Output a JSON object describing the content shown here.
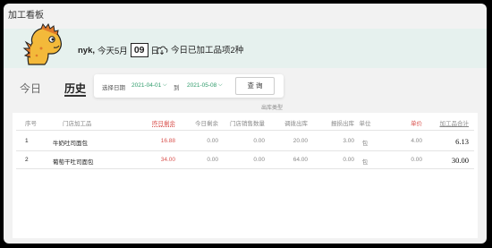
{
  "window": {
    "title": "加工看板"
  },
  "hero": {
    "user_name": "nyk,",
    "today_prefix": "今天5月",
    "day": "09",
    "day_suffix": "日",
    "processed_text": "今日已加工品项2种"
  },
  "tabs": [
    {
      "label": "今日",
      "active": false
    },
    {
      "label": "历史",
      "active": true
    }
  ],
  "filter": {
    "date_label": "选择日期",
    "start_date": "2021-04-01",
    "to_label": "到",
    "end_date": "2021-05-08",
    "query_label": "查 询"
  },
  "table": {
    "group_header": "出库类型",
    "columns": [
      "序号",
      "门店加工品",
      "昨日剩余",
      "今日剩余",
      "门店销售数量",
      "调拨出库",
      "报损出库",
      "单位",
      "单价",
      "加工品合计"
    ],
    "rows": [
      {
        "idx": "1",
        "name": "牛奶吐司面包",
        "prev": "16.88",
        "today": "0.00",
        "store_sales": "0.00",
        "transfer": "20.00",
        "scrap": "3.00",
        "unit": "包",
        "price": "4.00",
        "total": "6.13"
      },
      {
        "idx": "2",
        "name": "葡萄干吐司面包",
        "prev": "34.00",
        "today": "0.00",
        "store_sales": "0.00",
        "transfer": "64.00",
        "scrap": "0.00",
        "unit": "包",
        "price": "0.00",
        "total": "30.00"
      }
    ]
  },
  "colors": {
    "accent_green": "#2e9b6a",
    "accent_red": "#d9534f",
    "hero_bg": "#e6f1ee",
    "dino": "#f3b93a"
  }
}
